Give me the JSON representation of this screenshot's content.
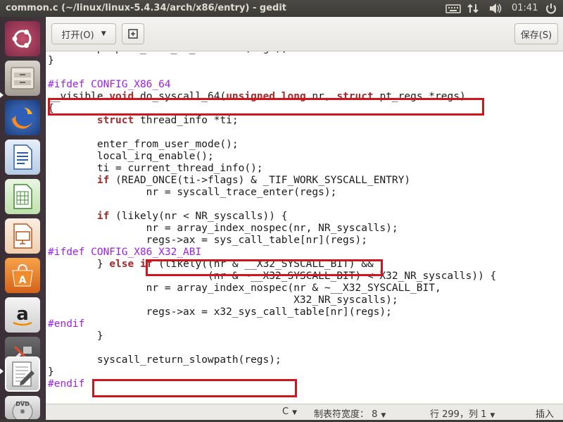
{
  "window": {
    "title": "common.c (~/linux/linux-5.4.34/arch/x86/entry) - gedit"
  },
  "panel": {
    "clock": "01:41"
  },
  "launcher": {
    "items": [
      {
        "name": "ubuntu-dash"
      },
      {
        "name": "files"
      },
      {
        "name": "firefox"
      },
      {
        "name": "libreoffice-writer"
      },
      {
        "name": "libreoffice-calc"
      },
      {
        "name": "libreoffice-impress"
      },
      {
        "name": "ubuntu-software"
      },
      {
        "name": "amazon"
      },
      {
        "name": "system-settings"
      },
      {
        "name": "gedit"
      },
      {
        "name": "dvd"
      }
    ]
  },
  "toolbar": {
    "open_label": "打开(O)",
    "save_label": "保存(S)"
  },
  "editor": {
    "lines": [
      "        prepare_exit_to_usermode(regs);",
      "}",
      "",
      "#ifdef CONFIG_X86_64",
      "__visible void do_syscall_64(unsigned long nr, struct pt_regs *regs)",
      "{",
      "        struct thread_info *ti;",
      "",
      "        enter_from_user_mode();",
      "        local_irq_enable();",
      "        ti = current_thread_info();",
      "        if (READ_ONCE(ti->flags) & _TIF_WORK_SYSCALL_ENTRY)",
      "                nr = syscall_trace_enter(regs);",
      "",
      "        if (likely(nr < NR_syscalls)) {",
      "                nr = array_index_nospec(nr, NR_syscalls);",
      "                regs->ax = sys_call_table[nr](regs);",
      "#ifdef CONFIG_X86_X32_ABI",
      "        } else if (likely((nr & __X32_SYSCALL_BIT) &&",
      "                          (nr & ~__X32_SYSCALL_BIT) < X32_NR_syscalls)) {",
      "                nr = array_index_nospec(nr & ~__X32_SYSCALL_BIT,",
      "                                        X32_NR_syscalls);",
      "                regs->ax = x32_sys_call_table[nr](regs);",
      "#endif",
      "        }",
      "",
      "        syscall_return_slowpath(regs);",
      "}",
      "#endif"
    ]
  },
  "statusbar": {
    "language": "C",
    "tab_width": "制表符宽度： 8",
    "position": "行 299，列 1",
    "mode": "插入"
  },
  "colors": {
    "highlight_border": "#d0151f",
    "keyword": "#a52a2a",
    "preprocessor": "#a020f0"
  }
}
